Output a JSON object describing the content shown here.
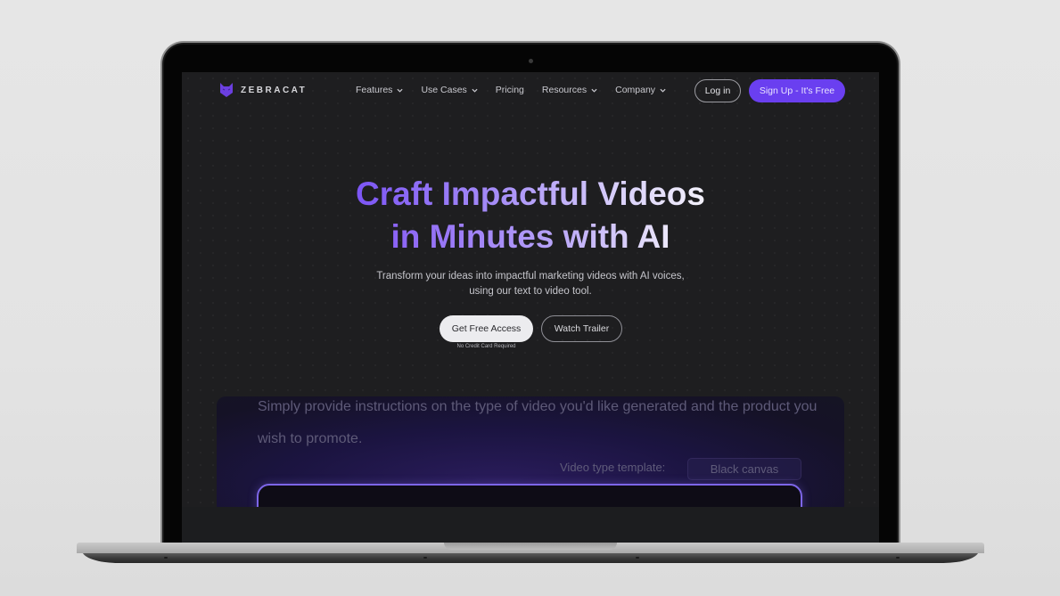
{
  "brand": {
    "name": "ZEBRACAT",
    "logo_icon": "cat-head-icon",
    "accent_color": "#6a3ff0"
  },
  "nav": {
    "items": [
      {
        "label": "Features",
        "has_dropdown": true
      },
      {
        "label": "Use Cases",
        "has_dropdown": true
      },
      {
        "label": "Pricing",
        "has_dropdown": false
      },
      {
        "label": "Resources",
        "has_dropdown": true
      },
      {
        "label": "Company",
        "has_dropdown": true
      }
    ],
    "login_label": "Log in",
    "signup_label": "Sign Up - It's Free"
  },
  "hero": {
    "title_line1": "Craft Impactful Videos",
    "title_line2": "in Minutes with AI",
    "subtitle_line1": "Transform your ideas into impactful marketing videos with AI voices,",
    "subtitle_line2": "using our text to video tool.",
    "primary_cta": "Get Free Access",
    "secondary_cta": "Watch Trailer",
    "cta_note": "No Credit Card Required"
  },
  "demo": {
    "instruction_text": "Simply provide instructions on the type of video you'd like generated and the product you wish to promote.",
    "template_label": "Video type template:",
    "template_value": "Black canvas",
    "prompt_value": ""
  }
}
